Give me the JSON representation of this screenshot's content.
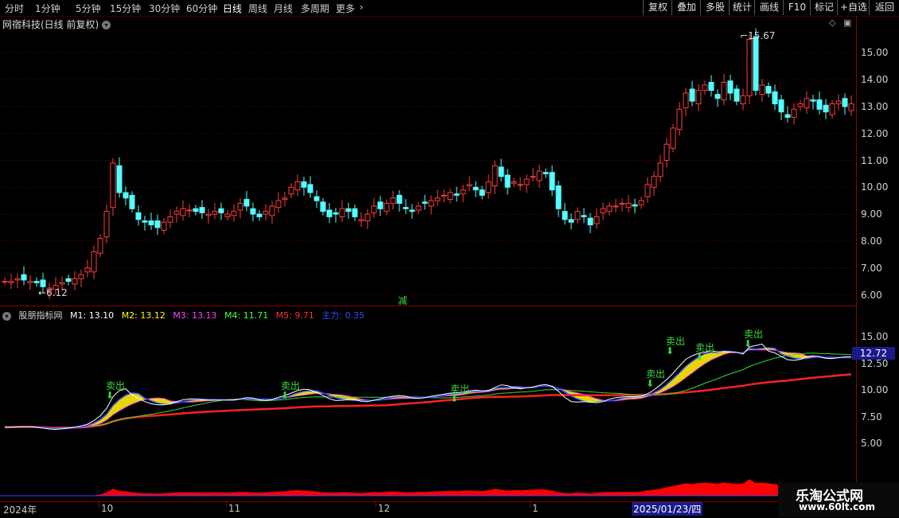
{
  "toolbar": {
    "periods": [
      "分时",
      "1分钟",
      "5分钟",
      "15分钟",
      "30分钟",
      "60分钟",
      "日线",
      "周线",
      "月线",
      "多周期",
      "更多"
    ],
    "active_period": "日线",
    "right_buttons": [
      "复权",
      "叠加",
      "多股",
      "统计",
      "画线",
      "F10",
      "标记",
      "+自选",
      "返回"
    ]
  },
  "stock": {
    "title": "网宿科技(日线 前复权)"
  },
  "main_chart": {
    "y_ticks": [
      "15.00",
      "14.00",
      "13.00",
      "12.00",
      "11.00",
      "10.00",
      "9.00",
      "8.00",
      "7.00",
      "6.00"
    ],
    "high_label": "15.67",
    "low_label": "6.12",
    "signal_reduce": "减",
    "up_color": "#ff3c3c",
    "down_color": "#54ffff"
  },
  "indicator": {
    "name": "股朋指标网",
    "values": [
      {
        "label": "M1: 13.10",
        "color": "#ffffff"
      },
      {
        "label": "M2: 13.12",
        "color": "#ffff00"
      },
      {
        "label": "M3: 13.13",
        "color": "#ff44ff"
      },
      {
        "label": "M4: 11.71",
        "color": "#44ff44"
      },
      {
        "label": "M5: 9.71",
        "color": "#ff3030"
      },
      {
        "label": "主力: 0.35",
        "color": "#3050ff"
      }
    ],
    "y_ticks": [
      "15.00",
      "12.50",
      "10.00",
      "7.50",
      "5.00"
    ],
    "current_value": "12.72",
    "sell_label": "卖出"
  },
  "time_axis": {
    "labels": [
      "2024年",
      "10",
      "11",
      "12",
      "1"
    ],
    "cursor_date": "2025/01/23/四"
  },
  "watermark": {
    "line1": "乐淘公式网",
    "line2": "www.60lt.com"
  }
}
